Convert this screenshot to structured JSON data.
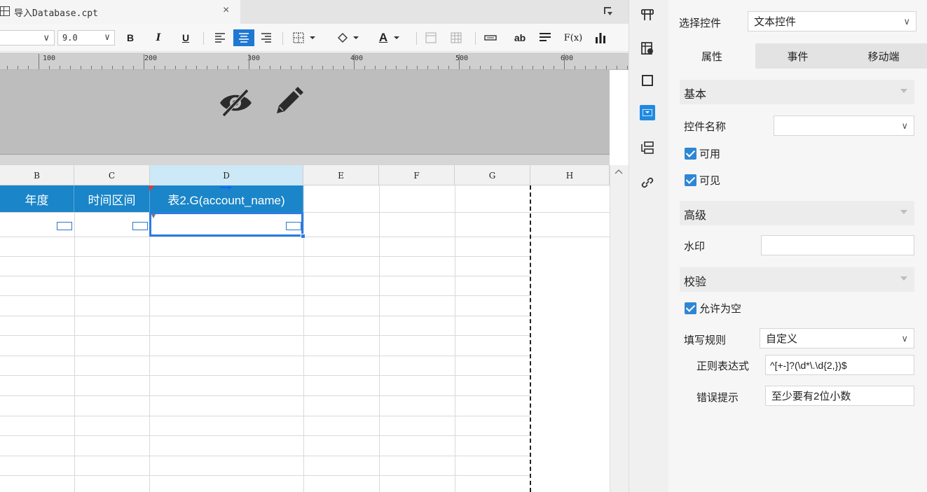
{
  "tab": {
    "title": "导入Database.cpt",
    "close": "×"
  },
  "toolbar": {
    "font_size": "9.0",
    "bold": "B",
    "italic": "I",
    "underline": "U",
    "text_color_glyph": "A",
    "ab_label": "ab",
    "formula_label": "F(x)",
    "active_tool": "align-center"
  },
  "ruler": {
    "labels": [
      "100",
      "200",
      "300",
      "400",
      "500",
      "600"
    ]
  },
  "columns": [
    "B",
    "C",
    "D",
    "E",
    "F",
    "G",
    "H"
  ],
  "selected_column": "D",
  "header_cells": [
    "年度",
    "时间区间",
    "表2.G(account_name)"
  ],
  "right_panel": {
    "select_control_label": "选择控件",
    "select_control_value": "文本控件",
    "tabs": [
      "属性",
      "事件",
      "移动端"
    ],
    "active_tab": "属性",
    "sections": {
      "basic": "基本",
      "advanced": "高级",
      "validation": "校验"
    },
    "control_name_label": "控件名称",
    "control_name_value": "",
    "enabled_label": "可用",
    "visible_label": "可见",
    "watermark_label": "水印",
    "watermark_value": "",
    "allow_empty_label": "允许为空",
    "fill_rule_label": "填写规则",
    "fill_rule_value": "自定义",
    "regex_label": "正则表达式",
    "regex_value": "^[+-]?(\\d*\\.\\d{2,})$",
    "error_label": "错误提示",
    "error_value": "至少要有2位小数"
  },
  "colors": {
    "header_blue": "#1a85c8",
    "selection_blue": "#2c7be5",
    "checkbox_blue": "#2f86d4"
  }
}
